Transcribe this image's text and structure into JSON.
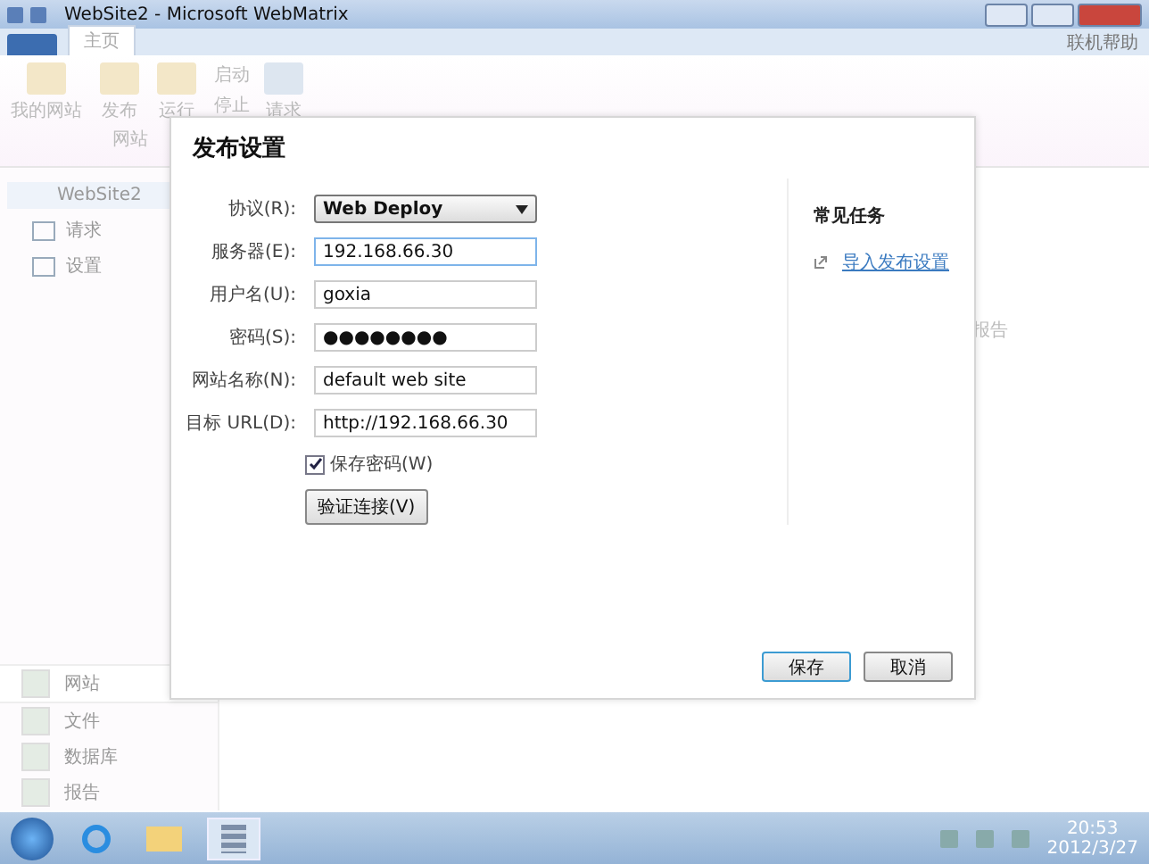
{
  "window": {
    "title": "WebSite2 - Microsoft WebMatrix"
  },
  "ribbon": {
    "tabs": [
      {
        "label": "主页",
        "selected": true
      }
    ],
    "help": "联机帮助",
    "buttons": [
      "我的网站",
      "发布",
      "运行"
    ],
    "small_buttons": [
      "启动",
      "停止"
    ],
    "request": "请求",
    "group_label": "网站"
  },
  "tree": {
    "root": {
      "label": "WebSite2",
      "selected": true
    },
    "children": [
      {
        "label": "请求",
        "selected": false
      },
      {
        "label": "设置",
        "selected": false
      }
    ]
  },
  "background": {
    "report_label": "报告"
  },
  "nav": [
    {
      "label": "网站",
      "selected": true
    },
    {
      "label": "文件",
      "selected": false
    },
    {
      "label": "数据库",
      "selected": false
    },
    {
      "label": "报告",
      "selected": false
    }
  ],
  "dialog": {
    "title": "发布设置",
    "fields": [
      {
        "kind": "select",
        "label": "协议(R):",
        "value": "Web Deploy"
      },
      {
        "kind": "text",
        "label": "服务器(E):",
        "value": "192.168.66.30"
      },
      {
        "kind": "text",
        "label": "用户名(U):",
        "value": "goxia"
      },
      {
        "kind": "password",
        "label": "密码(S):",
        "value": "●●●●●●●●"
      },
      {
        "kind": "text",
        "label": "网站名称(N):",
        "value": "default web site"
      },
      {
        "kind": "text",
        "label": "目标 URL(D):",
        "value": "http://192.168.66.30"
      }
    ],
    "save_password": {
      "label": "保存密码(W)",
      "checked": true
    },
    "verify_button": "验证连接(V)",
    "tasks_title": "常见任务",
    "task_link": "导入发布设置",
    "buttons": [
      "保存",
      "取消"
    ]
  },
  "taskbar": {
    "time": "20:53",
    "date": "2012/3/27"
  }
}
